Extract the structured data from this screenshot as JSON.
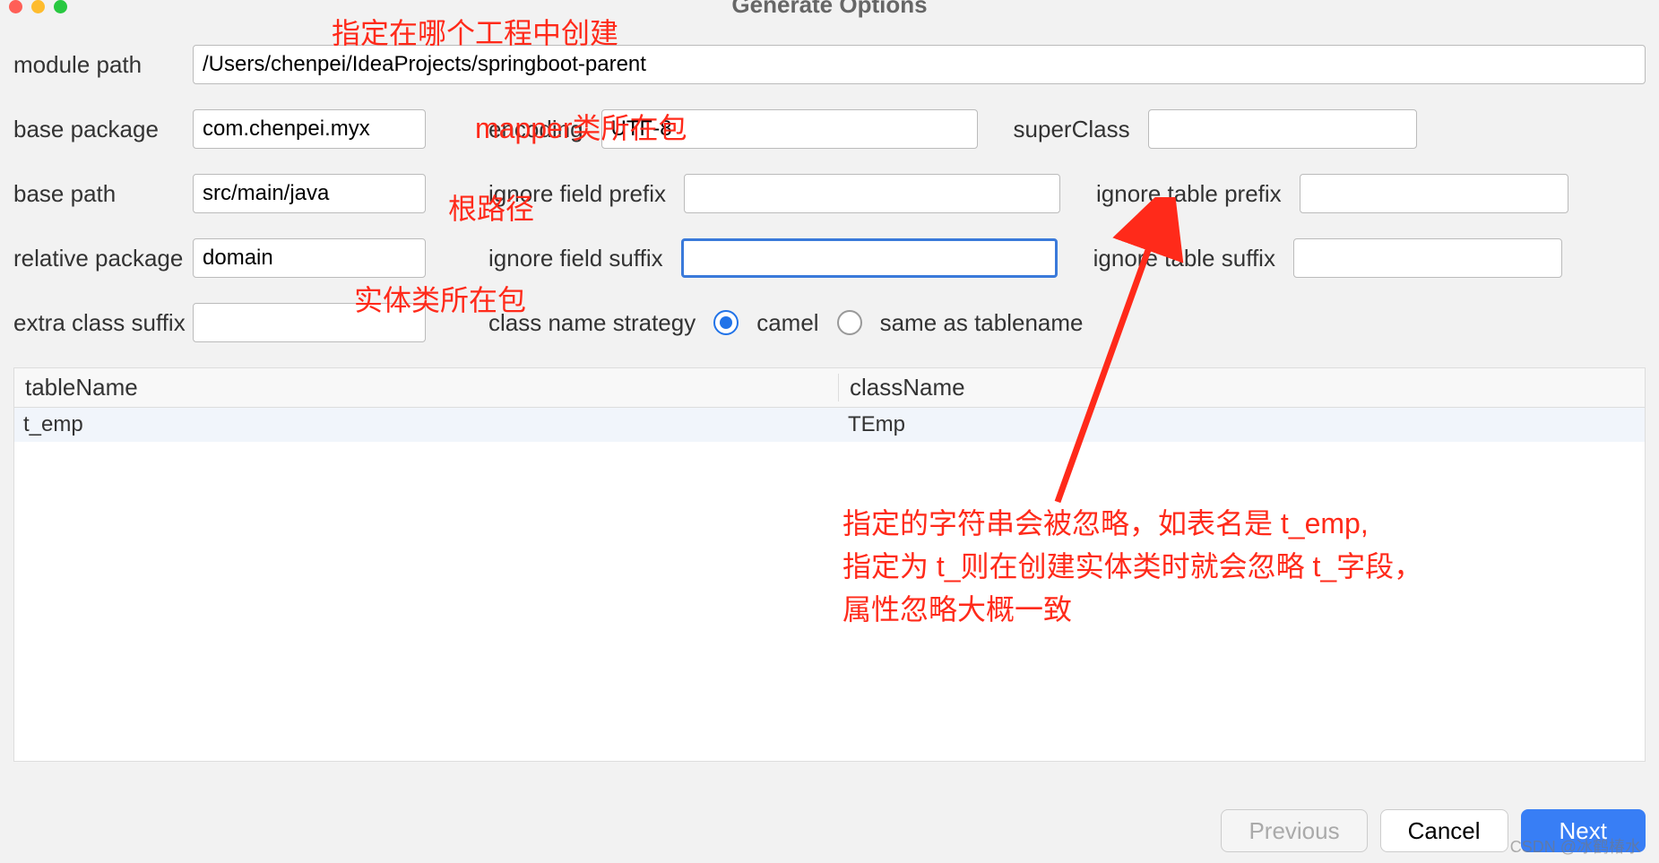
{
  "window_title": "Generate Options",
  "labels": {
    "module_path": "module path",
    "base_package": "base package",
    "encoding": "encoding",
    "super_class": "superClass",
    "base_path": "base path",
    "ignore_field_prefix": "ignore field prefix",
    "ignore_table_prefix": "ignore table prefix",
    "relative_package": "relative package",
    "ignore_field_suffix": "ignore field suffix",
    "ignore_table_suffix": "ignore table suffix",
    "extra_class_suffix": "extra class suffix",
    "class_name_strategy": "class name strategy",
    "radio_camel": "camel",
    "radio_same": "same as tablename"
  },
  "values": {
    "module_path": "/Users/chenpei/IdeaProjects/springboot-parent",
    "base_package": "com.chenpei.myx",
    "encoding": "UTF-8",
    "super_class": "",
    "base_path": "src/main/java",
    "ignore_field_prefix": "",
    "ignore_table_prefix": "",
    "relative_package": "domain",
    "ignore_field_suffix": "",
    "ignore_table_suffix": "",
    "extra_class_suffix": ""
  },
  "table": {
    "headers": {
      "tableName": "tableName",
      "className": "className"
    },
    "rows": [
      {
        "tableName": "t_emp",
        "className": "TEmp"
      }
    ]
  },
  "buttons": {
    "previous": "Previous",
    "cancel": "Cancel",
    "next": "Next"
  },
  "annotations": {
    "a1": "指定在哪个工程中创建",
    "a2": "mapper类所在包",
    "a3": "根路径",
    "a4": "实体类所在包",
    "a5_line1": "指定的字符串会被忽略，如表名是 t_emp,",
    "a5_line2": "指定为 t_则在创建实体类时就会忽略 t_字段，",
    "a5_line3": "属性忽略大概一致"
  },
  "watermark": "CSDN @冰鹤椿水"
}
